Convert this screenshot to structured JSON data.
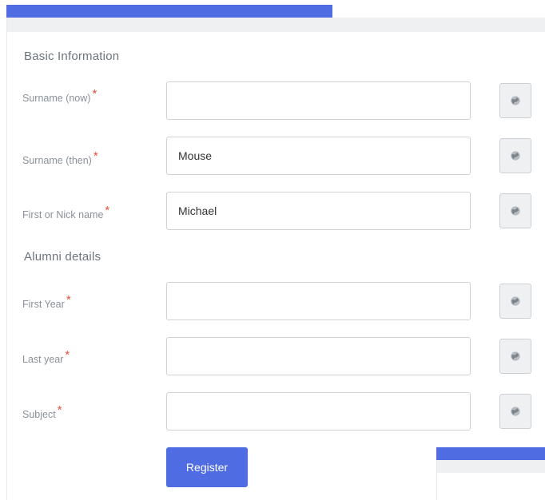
{
  "basic_section": {
    "title": "Basic Information",
    "fields": [
      {
        "label": "Surname (now)",
        "value": "",
        "required": "*"
      },
      {
        "label": "Surname (then)",
        "value": "Mouse",
        "required": "*"
      },
      {
        "label": "First or Nick name",
        "value": "Michael",
        "required": "*"
      }
    ]
  },
  "alumni_section": {
    "title": "Alumni details",
    "fields": [
      {
        "label": "First Year",
        "value": "",
        "required": "*"
      },
      {
        "label": "Last year",
        "value": "",
        "required": "*"
      },
      {
        "label": "Subject",
        "value": "",
        "required": "*"
      }
    ]
  },
  "register_label": "Register",
  "icons": {
    "privacy_toggle": "globe-icon"
  },
  "colors": {
    "accent": "#4f6ce3",
    "required": "#e0513c",
    "panel_bg": "#eef0f2"
  }
}
